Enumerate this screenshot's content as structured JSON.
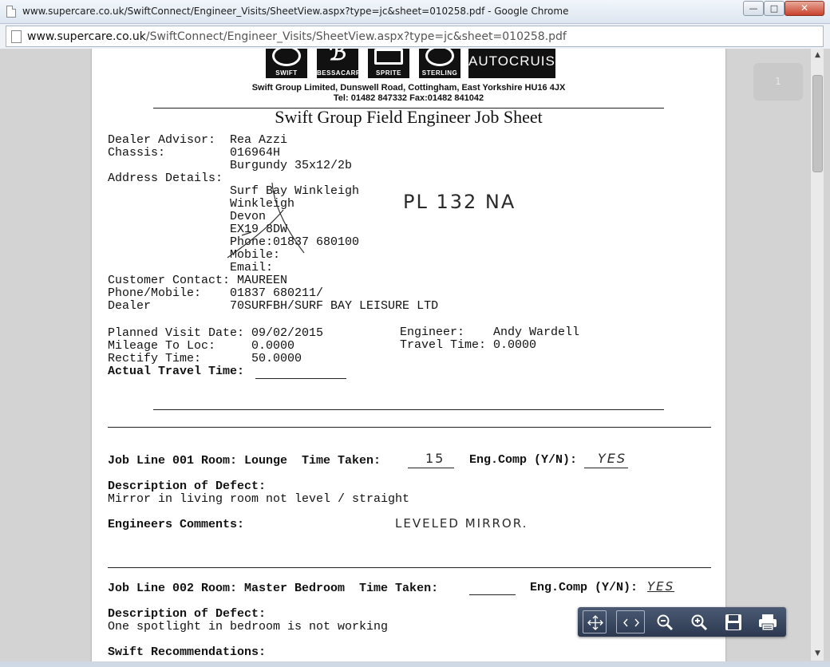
{
  "window": {
    "title": "www.supercare.co.uk/SwiftConnect/Engineer_Visits/SheetView.aspx?type=jc&sheet=010258.pdf - Google Chrome",
    "minimize_glyph": "—",
    "maximize_glyph": "□",
    "close_glyph": "✕"
  },
  "address": {
    "host": "www.supercare.co.uk",
    "path": "/SwiftConnect/Engineer_Visits/SheetView.aspx?type=jc&sheet=010258.pdf"
  },
  "viewer": {
    "page_indicator": "1",
    "toolbar": {
      "fit_page_icon": "fit-page-icon",
      "fit_width_icon": "fit-width-icon",
      "zoom_out_icon": "zoom-out-icon",
      "zoom_in_icon": "zoom-in-icon",
      "save_icon": "save-icon",
      "print_icon": "print-icon"
    }
  },
  "document": {
    "logos": [
      "SWIFT",
      "BESSACARR",
      "SPRITE",
      "STERLING",
      "AUTOCRUISE"
    ],
    "company_line1": "Swift Group Limited, Dunswell Road, Cottingham, East Yorkshire HU16 4JX",
    "company_line2": "Tel: 01482 847332 Fax:01482 841042",
    "title": "Swift Group Field Engineer Job Sheet",
    "header_block": "Dealer Advisor:  Rea Azzi\nChassis:         016964H\n                 Burgundy 35x12/2b\nAddress Details:\n                 Surf Bay Winkleigh\n                 Winkleigh\n                 Devon\n                 EX19 8DW\n                 Phone:01837 680100\n                 Mobile:\n                 Email:\nCustomer Contact: MAUREEN\nPhone/Mobile:    01837 680211/\nDealer           70SURFBH/SURF BAY LEISURE LTD",
    "visit_block_left": "Planned Visit Date: 09/02/2015\nMileage To Loc:     0.0000\nRectify Time:       50.0000",
    "actual_travel_label": "Actual Travel Time:",
    "visit_block_right": "Engineer:    Andy Wardell\nTravel Time: 0.0000",
    "handwritten_postcode": "PL 132 NA",
    "job1_header": "Job Line 001 Room: Lounge  Time Taken:",
    "job1_time": "15",
    "job1_comp_label": "Eng.Comp (Y/N):",
    "job1_comp": "YES",
    "job1_defect_label": "Description of Defect:",
    "job1_defect": "Mirror in living room not level / straight",
    "job1_comments_label": "Engineers Comments:",
    "job1_comments": "LEVELED MIRROR.",
    "job2_header": "Job Line 002 Room: Master Bedroom  Time Taken:",
    "job2_comp_label": "Eng.Comp (Y/N):",
    "job2_comp": "YES",
    "job2_defect_label": "Description of Defect:",
    "job2_defect": "One spotlight in bedroom is not working",
    "job2_recs_label": "Swift Recommendations:"
  }
}
